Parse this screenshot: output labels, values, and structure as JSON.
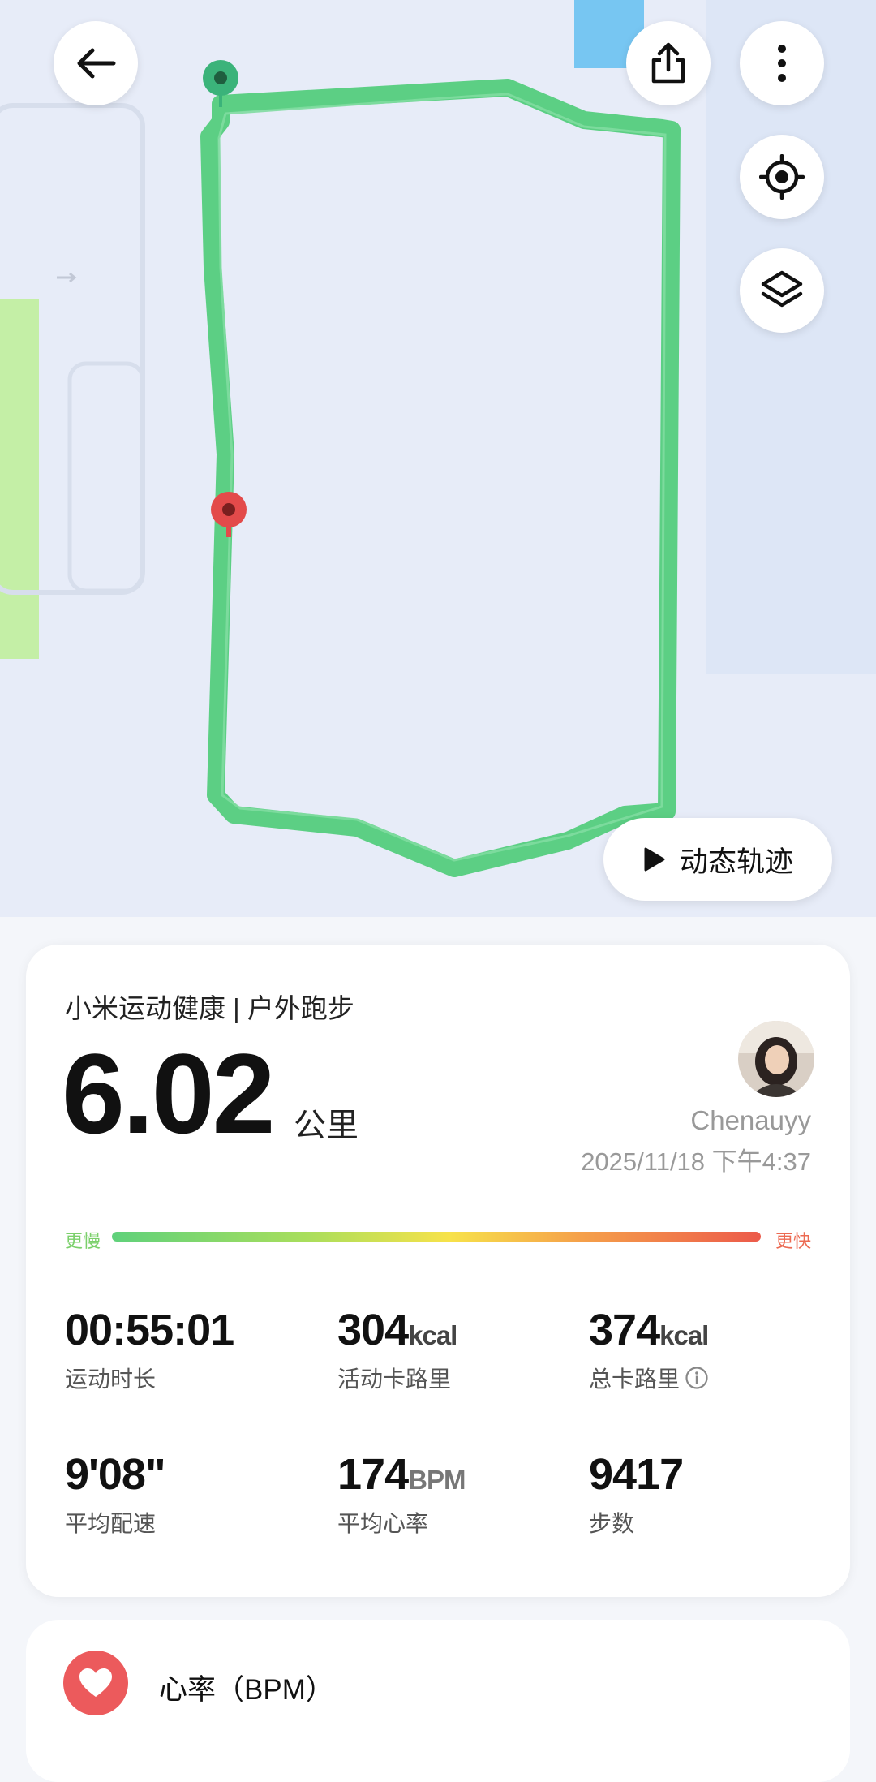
{
  "map": {
    "track_color": "#5ccf84",
    "start_marker_color": "#3bb37a",
    "end_marker_color": "#e34a4a",
    "replay_button": {
      "icon": "play-icon",
      "label": "动态轨迹"
    }
  },
  "toolbar": {
    "back_icon": "arrow-left-icon",
    "share_icon": "share-icon",
    "more_icon": "more-vertical-icon",
    "locate_icon": "locate-icon",
    "layers_icon": "layers-icon"
  },
  "summary": {
    "app_title": "小米运动健康 | 户外跑步",
    "distance": "6.02",
    "distance_unit": "公里",
    "username": "Chenauyy",
    "datetime": "2025/11/18 下午4:37",
    "pace_slow": "更慢",
    "pace_fast": "更快"
  },
  "stats": [
    {
      "value": "00:55:01",
      "unit": "",
      "label": "运动时长"
    },
    {
      "value": "304",
      "unit": "kcal",
      "label": "活动卡路里"
    },
    {
      "value": "374",
      "unit": "kcal",
      "label": "总卡路里",
      "icon": "info-icon"
    },
    {
      "value": "9'08\"",
      "unit": "",
      "label": "平均配速"
    },
    {
      "value": "174",
      "unit": "BPM",
      "label": "平均心率"
    },
    {
      "value": "9417",
      "unit": "",
      "label": "步数"
    }
  ],
  "heart_rate": {
    "icon": "heart-icon",
    "title": "心率（BPM）",
    "color": "#ec5a5c"
  }
}
